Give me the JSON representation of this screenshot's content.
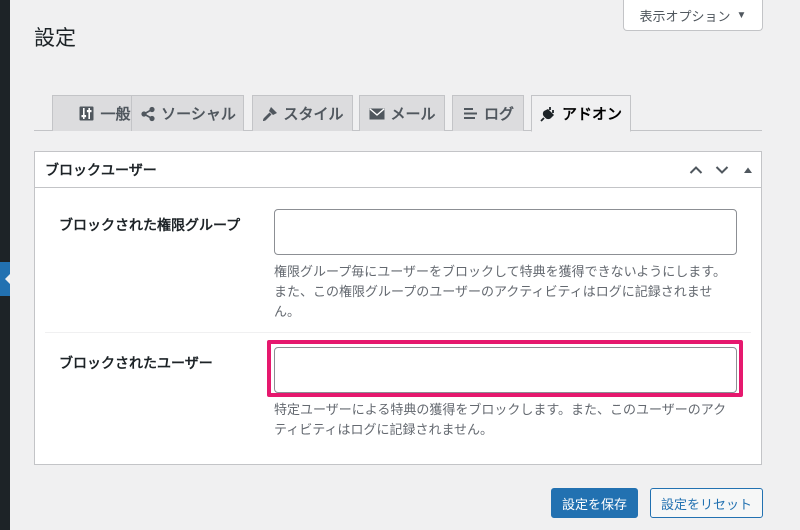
{
  "page": {
    "title": "設定",
    "screen_options_label": "表示オプション"
  },
  "tabs": [
    {
      "label": "一般",
      "icon": "sliders-icon"
    },
    {
      "label": "ソーシャル",
      "icon": "share-icon"
    },
    {
      "label": "スタイル",
      "icon": "paintbrush-icon"
    },
    {
      "label": "メール",
      "icon": "email-icon"
    },
    {
      "label": "ログ",
      "icon": "list-icon"
    },
    {
      "label": "アドオン",
      "icon": "plugin-icon",
      "active": true
    }
  ],
  "panel": {
    "title": "ブロックユーザー",
    "rows": [
      {
        "label": "ブロックされた権限グループ",
        "value": "",
        "description": "権限グループ毎にユーザーをブロックして特典を獲得できないようにします。また、この権限グループのユーザーのアクティビティはログに記録されません。"
      },
      {
        "label": "ブロックされたユーザー",
        "value": "",
        "description": "特定ユーザーによる特典の獲得をブロックします。また、このユーザーのアクティビティはログに記録されません。"
      }
    ]
  },
  "buttons": {
    "save": "設定を保存",
    "reset": "設定をリセット"
  },
  "colors": {
    "primary": "#2271b1",
    "highlight": "#e6186e",
    "admin_dark": "#1d2327"
  }
}
